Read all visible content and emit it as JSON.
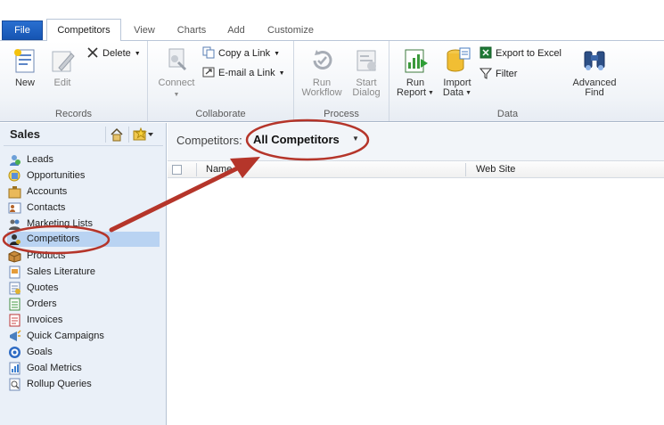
{
  "tabs": [
    {
      "label": "File"
    },
    {
      "label": "Competitors"
    },
    {
      "label": "View"
    },
    {
      "label": "Charts"
    },
    {
      "label": "Add"
    },
    {
      "label": "Customize"
    }
  ],
  "ribbon": {
    "records": {
      "label": "Records",
      "new": "New",
      "edit": "Edit",
      "delete": "Delete"
    },
    "collaborate": {
      "label": "Collaborate",
      "connect": "Connect",
      "copy_link": "Copy a Link",
      "email_link": "E-mail a Link"
    },
    "process": {
      "label": "Process",
      "run_workflow_1": "Run",
      "run_workflow_2": "Workflow",
      "start_dialog_1": "Start",
      "start_dialog_2": "Dialog"
    },
    "data": {
      "label": "Data",
      "run_report_1": "Run",
      "run_report_2": "Report",
      "import_data_1": "Import",
      "import_data_2": "Data",
      "export_excel": "Export to Excel",
      "filter": "Filter",
      "advanced_find_1": "Advanced",
      "advanced_find_2": "Find"
    }
  },
  "nav": {
    "title": "Sales",
    "items": [
      {
        "label": "Leads",
        "icon": "leads-icon"
      },
      {
        "label": "Opportunities",
        "icon": "opportunities-icon"
      },
      {
        "label": "Accounts",
        "icon": "accounts-icon"
      },
      {
        "label": "Contacts",
        "icon": "contacts-icon"
      },
      {
        "label": "Marketing Lists",
        "icon": "marketing-lists-icon"
      },
      {
        "label": "Competitors",
        "icon": "competitors-icon"
      },
      {
        "label": "Products",
        "icon": "products-icon"
      },
      {
        "label": "Sales Literature",
        "icon": "sales-literature-icon"
      },
      {
        "label": "Quotes",
        "icon": "quotes-icon"
      },
      {
        "label": "Orders",
        "icon": "orders-icon"
      },
      {
        "label": "Invoices",
        "icon": "invoices-icon"
      },
      {
        "label": "Quick Campaigns",
        "icon": "quick-campaigns-icon"
      },
      {
        "label": "Goals",
        "icon": "goals-icon"
      },
      {
        "label": "Goal Metrics",
        "icon": "goal-metrics-icon"
      },
      {
        "label": "Rollup Queries",
        "icon": "rollup-queries-icon"
      }
    ]
  },
  "main": {
    "view_prefix": "Competitors:",
    "view_name": "All Competitors",
    "columns": [
      "Name",
      "Web Site"
    ]
  },
  "colors": {
    "annotation": "#c0392b",
    "selected": "#b9d3f2",
    "file_tab": "#1f63c6"
  }
}
